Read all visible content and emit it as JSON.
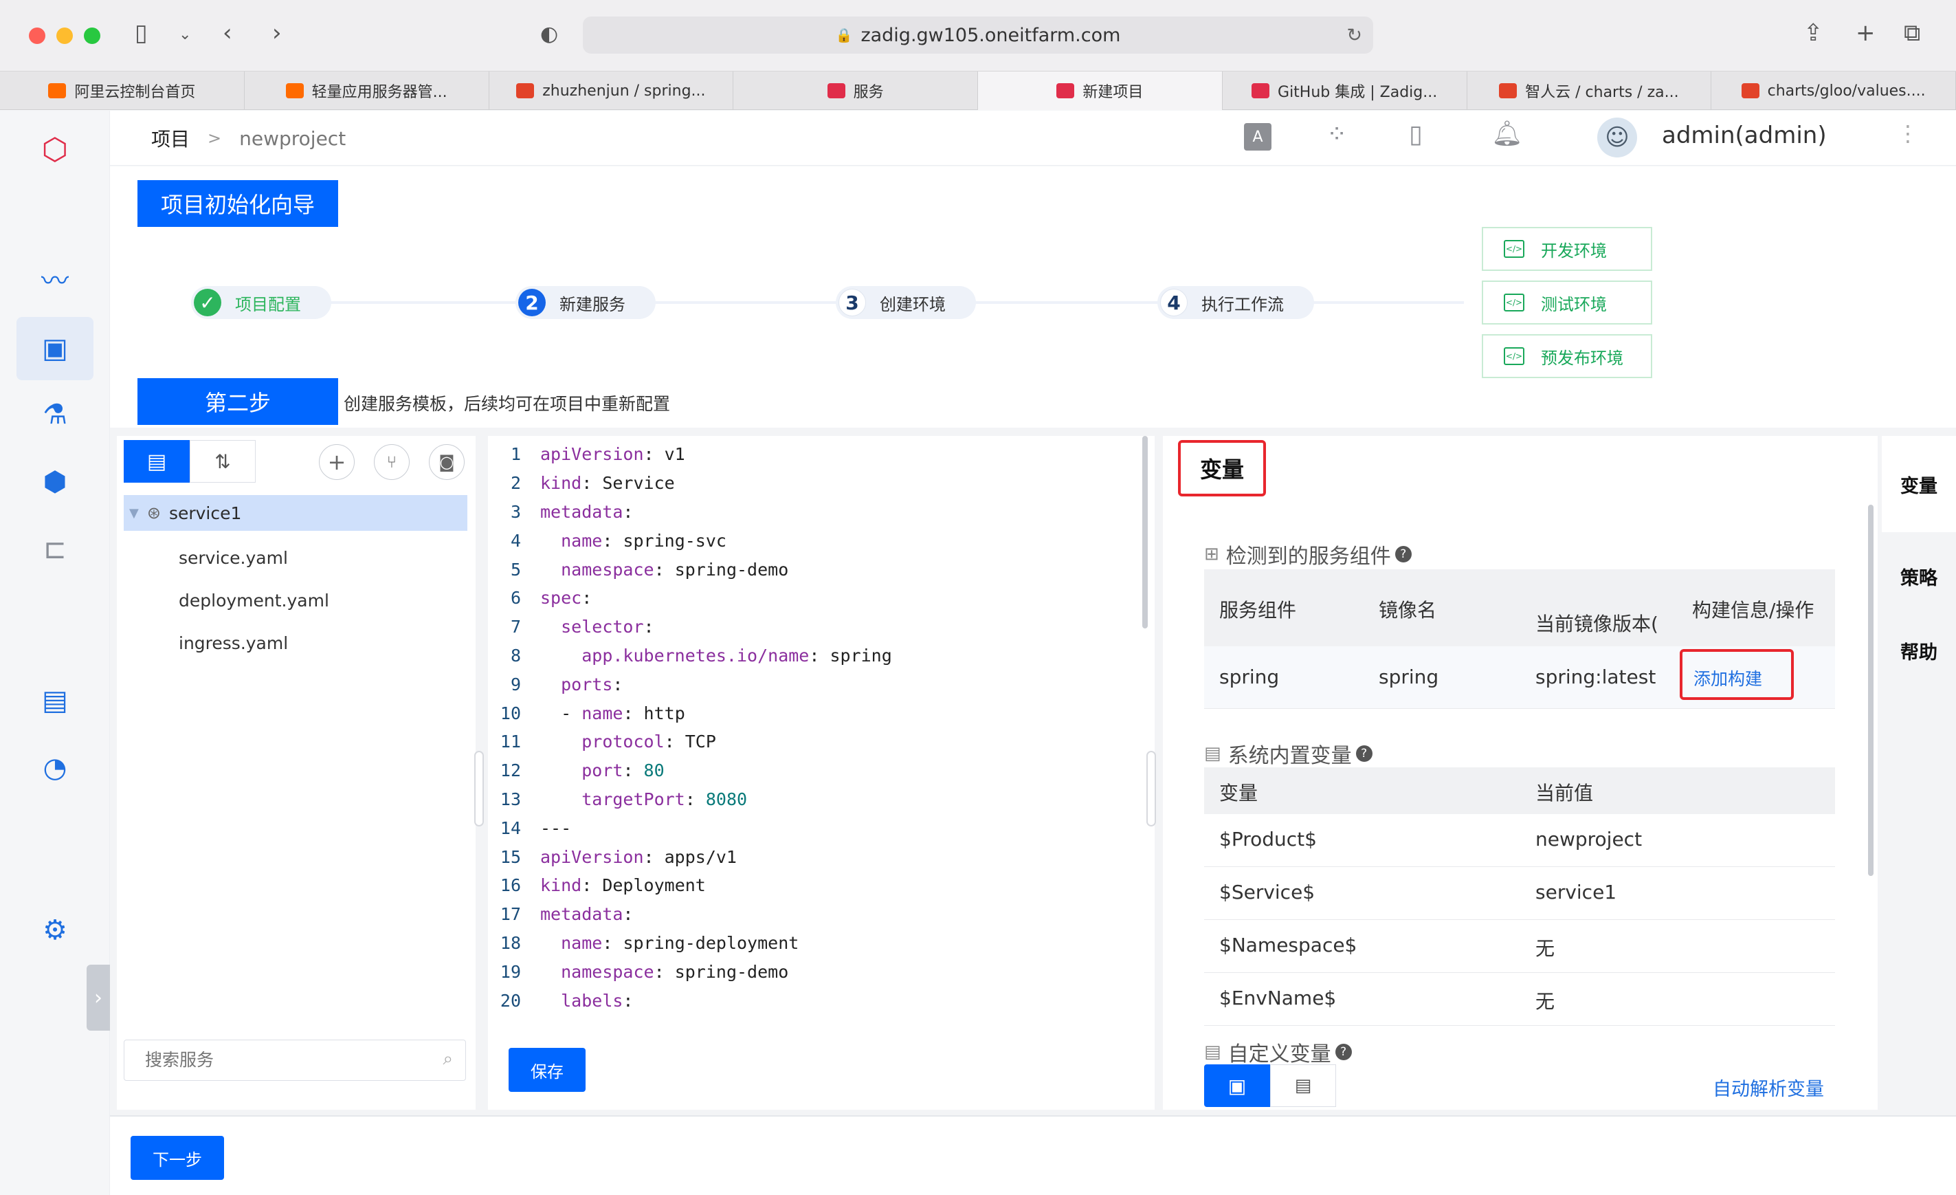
{
  "browser": {
    "url": "zadig.gw105.oneitfarm.com",
    "tabs": [
      {
        "label": "阿里云控制台首页",
        "favicon": "#ff6a00"
      },
      {
        "label": "轻量应用服务器管...",
        "favicon": "#ff6a00"
      },
      {
        "label": "zhuzhenjun / spring...",
        "favicon": "#e24329"
      },
      {
        "label": "服务",
        "favicon": "#e02d4a"
      },
      {
        "label": "新建项目",
        "favicon": "#e02d4a",
        "active": true
      },
      {
        "label": "GitHub 集成 | Zadig...",
        "favicon": "#e02d4a"
      },
      {
        "label": "智人云 / charts / za...",
        "favicon": "#e24329"
      },
      {
        "label": "charts/gloo/values....",
        "favicon": "#e24329"
      }
    ]
  },
  "header": {
    "breadcrumb_root": "项目",
    "breadcrumb_sep": ">",
    "breadcrumb_current": "newproject",
    "user": "admin(admin)"
  },
  "wizard": {
    "title": "项目初始化向导",
    "steps": [
      {
        "num": "✓",
        "label": "项目配置",
        "state": "done"
      },
      {
        "num": "2",
        "label": "新建服务",
        "state": "current"
      },
      {
        "num": "3",
        "label": "创建环境",
        "state": "todo"
      },
      {
        "num": "4",
        "label": "执行工作流",
        "state": "todo"
      }
    ],
    "envs": [
      "开发环境",
      "测试环境",
      "预发布环境"
    ],
    "step_badge": "第二步",
    "step_desc": "创建服务模板，后续均可在项目中重新配置"
  },
  "tree": {
    "service": "service1",
    "files": [
      "service.yaml",
      "deployment.yaml",
      "ingress.yaml"
    ],
    "search_placeholder": "搜索服务"
  },
  "editor": {
    "lines": [
      {
        "n": "1",
        "indent": "",
        "k": "apiVersion",
        "v": " v1"
      },
      {
        "n": "2",
        "indent": "",
        "k": "kind",
        "v": " Service"
      },
      {
        "n": "3",
        "indent": "",
        "k": "metadata",
        "v": ""
      },
      {
        "n": "4",
        "indent": "  ",
        "k": "name",
        "v": " spring-svc"
      },
      {
        "n": "5",
        "indent": "  ",
        "k": "namespace",
        "v": " spring-demo"
      },
      {
        "n": "6",
        "indent": "",
        "k": "spec",
        "v": ""
      },
      {
        "n": "7",
        "indent": "  ",
        "k": "selector",
        "v": ""
      },
      {
        "n": "8",
        "indent": "    ",
        "k": "app.kubernetes.io/name",
        "v": " spring"
      },
      {
        "n": "9",
        "indent": "  ",
        "k": "ports",
        "v": ""
      },
      {
        "n": "10",
        "indent": "  - ",
        "k": "name",
        "v": " http"
      },
      {
        "n": "11",
        "indent": "    ",
        "k": "protocol",
        "v": " TCP"
      },
      {
        "n": "12",
        "indent": "    ",
        "k": "port",
        "v": " 80",
        "num": true
      },
      {
        "n": "13",
        "indent": "    ",
        "k": "targetPort",
        "v": " 8080",
        "num": true
      },
      {
        "n": "14",
        "indent": "",
        "k": "---",
        "v": "",
        "raw": true
      },
      {
        "n": "15",
        "indent": "",
        "k": "apiVersion",
        "v": " apps/v1"
      },
      {
        "n": "16",
        "indent": "",
        "k": "kind",
        "v": " Deployment"
      },
      {
        "n": "17",
        "indent": "",
        "k": "metadata",
        "v": ""
      },
      {
        "n": "18",
        "indent": "  ",
        "k": "name",
        "v": " spring-deployment"
      },
      {
        "n": "19",
        "indent": "  ",
        "k": "namespace",
        "v": " spring-demo"
      },
      {
        "n": "20",
        "indent": "  ",
        "k": "labels",
        "v": ""
      }
    ],
    "save_label": "保存"
  },
  "variables": {
    "title": "变量",
    "detected_title": "检测到的服务组件",
    "detected_headers": [
      "服务组件",
      "镜像名",
      "当前镜像版本(\n$IMAGE)",
      "构建信息/操作"
    ],
    "detected_row": {
      "component": "spring",
      "image": "spring",
      "version": "spring:latest",
      "action": "添加构建"
    },
    "system_title": "系统内置变量",
    "system_headers": [
      "变量",
      "当前值"
    ],
    "system_rows": [
      {
        "name": "$Product$",
        "value": "newproject"
      },
      {
        "name": "$Service$",
        "value": "service1"
      },
      {
        "name": "$Namespace$",
        "value": "无"
      },
      {
        "name": "$EnvName$",
        "value": "无"
      }
    ],
    "custom_title": "自定义变量",
    "auto_parse": "自动解析变量"
  },
  "right_tabs": [
    "变量",
    "策略",
    "帮助"
  ],
  "footer": {
    "next_label": "下一步"
  }
}
